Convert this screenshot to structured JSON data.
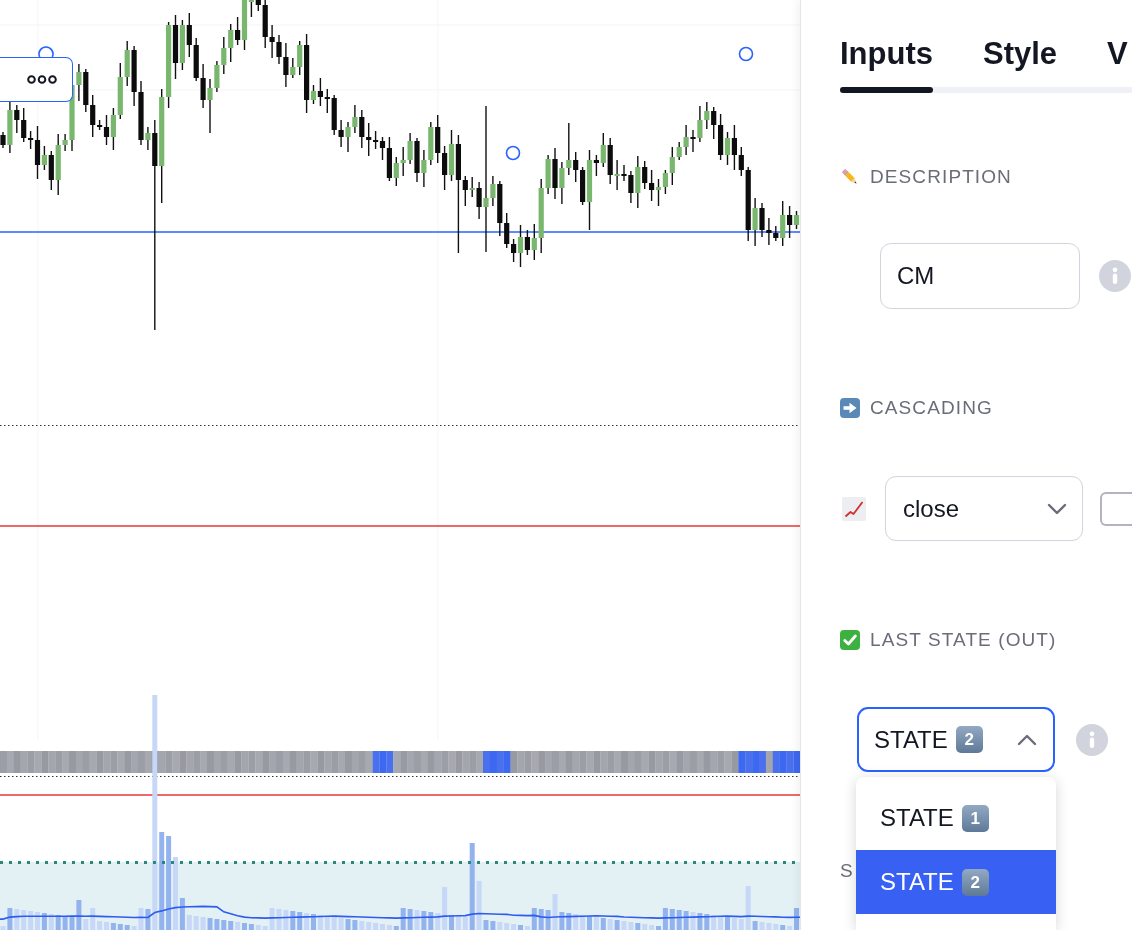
{
  "settings_panel": {
    "tabs": [
      {
        "label": "Inputs",
        "selected": true
      },
      {
        "label": "Style",
        "selected": false
      },
      {
        "label": "V",
        "selected": false
      }
    ],
    "sections": [
      {
        "kind": "text",
        "title": "DESCRIPTION",
        "value": "CM",
        "info": true
      },
      {
        "kind": "source",
        "title": "CASCADING",
        "value": "close",
        "expanded": false
      },
      {
        "kind": "select",
        "title": "LAST STATE (OUT)",
        "value": {
          "label": "STATE",
          "keycap": "2"
        },
        "expanded": true,
        "info": true,
        "options": [
          {
            "label": "STATE",
            "keycap": "1",
            "selected": false
          },
          {
            "label": "STATE",
            "keycap": "2",
            "selected": true
          }
        ]
      },
      {
        "kind": "label",
        "title": "S"
      }
    ]
  }
}
